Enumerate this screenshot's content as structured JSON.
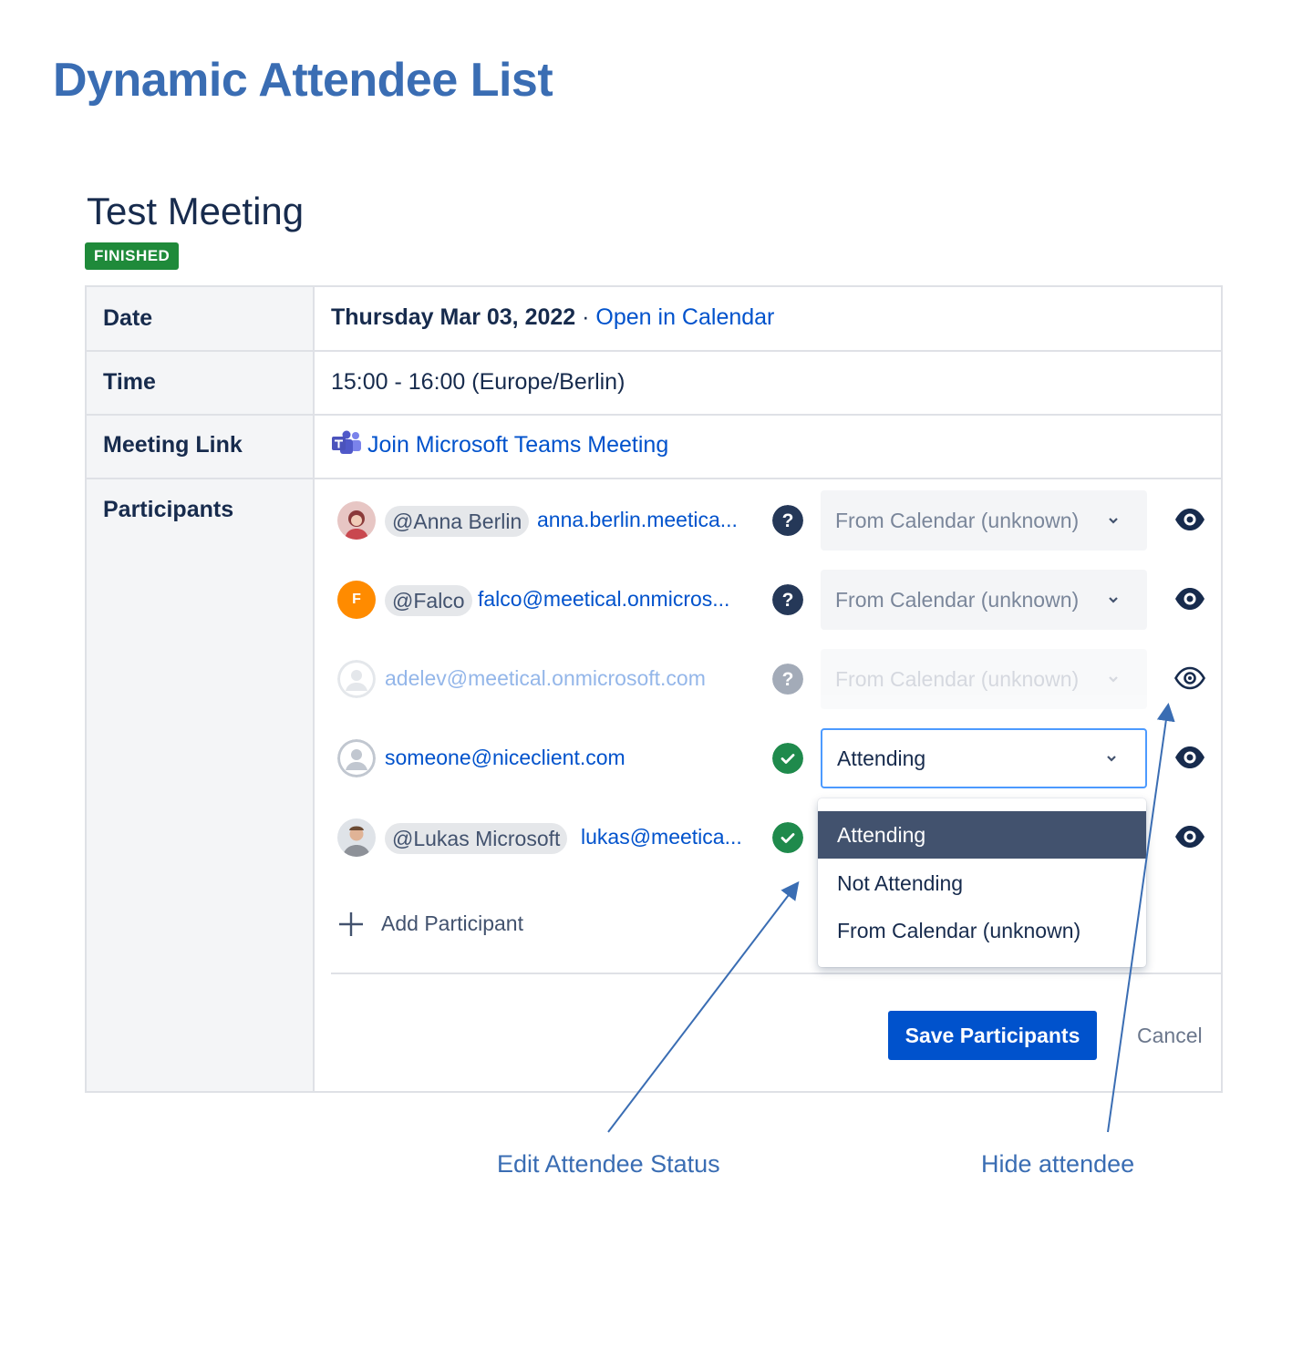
{
  "page": {
    "title": "Dynamic Attendee List"
  },
  "meeting": {
    "title": "Test Meeting",
    "badge": "FINISHED",
    "rows": {
      "date_label": "Date",
      "date_value": "Thursday Mar 03, 2022",
      "date_sep": " · ",
      "calendar_link": "Open in Calendar",
      "time_label": "Time",
      "time_value": "15:00 - 16:00 (Europe/Berlin)",
      "link_label": "Meeting Link",
      "teams_link": "Join Microsoft Teams Meeting",
      "participants_label": "Participants"
    }
  },
  "participants": [
    {
      "mention": "@Anna Berlin",
      "email": "anna.berlin.meetica...",
      "status_icon": "question-icon",
      "status": "From Calendar (unknown)",
      "hidden": false
    },
    {
      "mention": "@Falco",
      "avatar_letter": "F",
      "email": "falco@meetical.onmicros...",
      "status_icon": "question-icon",
      "status": "From Calendar (unknown)",
      "hidden": false
    },
    {
      "mention": "",
      "email": "adelev@meetical.onmicrosoft.com",
      "status_icon": "question-icon",
      "status": "From Calendar (unknown)",
      "hidden": true
    },
    {
      "mention": "",
      "email": "someone@niceclient.com",
      "status_icon": "check-icon",
      "status": "Attending",
      "hidden": false,
      "editing": true
    },
    {
      "mention": "@Lukas Microsoft",
      "email": "lukas@meetica...",
      "status_icon": "check-icon",
      "status": "",
      "hidden": false
    }
  ],
  "status_options": [
    "Attending",
    "Not Attending",
    "From Calendar (unknown)"
  ],
  "selected_option": "Attending",
  "actions": {
    "add_participant": "Add Participant",
    "save": "Save Participants",
    "cancel": "Cancel"
  },
  "annotations": {
    "edit_status": "Edit Attendee Status",
    "hide_attendee": "Hide attendee"
  },
  "colors": {
    "heading": "#3a6db3",
    "link": "#0052cc",
    "badge": "#1f8a3a",
    "primary_button": "#0052cc",
    "success": "#1f8a4c",
    "dropdown_selected": "#42526e"
  }
}
